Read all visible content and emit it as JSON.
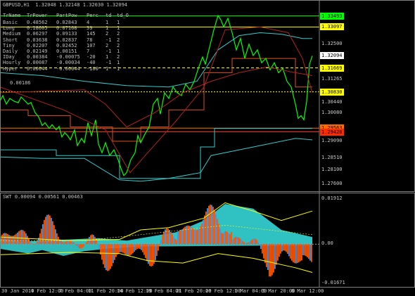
{
  "chart_data": {
    "type": "line",
    "main": {
      "header": "GBPUSD,H1  1.32048 1.32148 1.32030 1.32094",
      "symbol": "GBPUSD",
      "timeframe": "H1",
      "ohlc": {
        "open": 1.32048,
        "high": 1.32148,
        "low": 1.3203,
        "close": 1.32094
      },
      "ylim": [
        1.274,
        1.3375
      ],
      "y_ticks": [
        "1.33493",
        "1.33097",
        "1.32500",
        "1.32094",
        "1.31669",
        "1.31265",
        "1.30830",
        "1.30440",
        "1.30080",
        "1.29563",
        "1.29428",
        "1.29090",
        "1.28510",
        "1.28100",
        "1.27600"
      ],
      "price_labels": [
        {
          "text": "1.33493",
          "value": 1.3349,
          "color": "#00ff00"
        },
        {
          "text": "1.33097",
          "value": 1.331,
          "color": "#ffff00"
        },
        {
          "text": "1.32094",
          "value": 1.32094,
          "color": "#ffffff"
        },
        {
          "text": "1.31669",
          "value": 1.3167,
          "color": "#ffff00"
        },
        {
          "text": "1.30830",
          "value": 1.3083,
          "color": "#ffff00"
        },
        {
          "text": "1.29563",
          "value": 1.2956,
          "color": "#ff6a00"
        },
        {
          "text": "1.29428",
          "value": 1.2943,
          "color": "#ff2a00"
        }
      ],
      "table_headers": [
        "TrName",
        "TrPower",
        "PartPow",
        "Perc",
        "td",
        "td_O"
      ],
      "table_rows": [
        [
          "Basic",
          "0.48562",
          "0.02843",
          "4",
          "1",
          "1"
        ],
        [
          "Long",
          "0.18605",
          "0.07168",
          "39",
          "1",
          "1"
        ],
        [
          "Medium",
          "0.06297",
          "0.09133",
          "145",
          "2",
          "2"
        ],
        [
          "Short",
          "0.03638",
          "0.02837",
          "78",
          "-1",
          "2"
        ],
        [
          "Tiny",
          "0.02207",
          "0.02452",
          "107",
          "2",
          "2"
        ],
        [
          "Daily",
          "0.02149",
          "0.00151",
          "7",
          "-1",
          "1"
        ],
        [
          "IDay",
          "0.00384",
          "-0.00075",
          "-20",
          "1",
          "2"
        ],
        [
          "Hourly",
          "0.00087",
          "-0.00034",
          "-40",
          "-1",
          "1"
        ],
        [
          "Hyper",
          "0.00044",
          "-0.00044",
          "-100",
          "1",
          "1"
        ]
      ],
      "footer_value": "0.00186",
      "series": [
        {
          "points": [
            [
              0,
              1.305
            ],
            [
              4,
              1.307
            ],
            [
              9,
              1.304
            ],
            [
              14,
              1.306
            ],
            [
              20,
              1.305
            ],
            [
              26,
              1.3045
            ],
            [
              30,
              1.3065
            ],
            [
              34,
              1.3055
            ],
            [
              40,
              1.304
            ],
            [
              44,
              1.3046
            ],
            [
              50,
              1.301
            ],
            [
              55,
              1.2995
            ],
            [
              60,
              1.2965
            ],
            [
              64,
              1.2975
            ],
            [
              70,
              1.2955
            ],
            [
              74,
              1.2968
            ],
            [
              80,
              1.295
            ],
            [
              84,
              1.2962
            ],
            [
              88,
              1.2925
            ],
            [
              92,
              1.294
            ],
            [
              96,
              1.293
            ],
            [
              100,
              1.2915
            ],
            [
              106,
              1.295
            ],
            [
              110,
              1.2895
            ],
            [
              116,
              1.292
            ],
            [
              120,
              1.2905
            ],
            [
              125,
              1.2975
            ],
            [
              130,
              1.293
            ],
            [
              136,
              1.2985
            ],
            [
              140,
              1.29
            ],
            [
              145,
              1.287
            ],
            [
              150,
              1.2905
            ],
            [
              156,
              1.286
            ],
            [
              162,
              1.288
            ],
            [
              168,
              1.2845
            ],
            [
              172,
              1.2815
            ],
            [
              176,
              1.279
            ],
            [
              180,
              1.28
            ],
            [
              186,
              1.2845
            ],
            [
              192,
              1.287
            ],
            [
              196,
              1.293
            ],
            [
              200,
              1.2905
            ],
            [
              206,
              1.2935
            ],
            [
              212,
              1.296
            ],
            [
              218,
              1.304
            ],
            [
              224,
              1.306
            ],
            [
              228,
              1.3005
            ],
            [
              234,
              1.308
            ],
            [
              240,
              1.306
            ],
            [
              246,
              1.31
            ],
            [
              252,
              1.308
            ],
            [
              258,
              1.307
            ],
            [
              264,
              1.311
            ],
            [
              270,
              1.309
            ],
            [
              276,
              1.312
            ],
            [
              282,
              1.3165
            ],
            [
              288,
              1.3205
            ],
            [
              292,
              1.318
            ],
            [
              298,
              1.324
            ],
            [
              304,
              1.33
            ],
            [
              310,
              1.335
            ],
            [
              314,
              1.3335
            ],
            [
              318,
              1.331
            ],
            [
              324,
              1.334
            ],
            [
              330,
              1.329
            ],
            [
              336,
              1.323
            ],
            [
              342,
              1.327
            ],
            [
              348,
              1.32
            ],
            [
              354,
              1.325
            ],
            [
              360,
              1.321
            ],
            [
              366,
              1.323
            ],
            [
              372,
              1.3185
            ],
            [
              378,
              1.32
            ],
            [
              384,
              1.316
            ],
            [
              390,
              1.3185
            ],
            [
              396,
              1.315
            ],
            [
              402,
              1.3165
            ],
            [
              408,
              1.312
            ],
            [
              414,
              1.31
            ],
            [
              420,
              1.304
            ],
            [
              424,
              1.299
            ],
            [
              428,
              1.3
            ],
            [
              432,
              1.2985
            ],
            [
              436,
              1.305
            ],
            [
              440,
              1.318
            ],
            [
              444,
              1.3209
            ]
          ],
          "color": "#00ff00"
        },
        {
          "points": [
            [
              0,
              1.315
            ],
            [
              60,
              1.314
            ],
            [
              120,
              1.312
            ],
            [
              180,
              1.3105
            ],
            [
              240,
              1.31
            ],
            [
              280,
              1.312
            ],
            [
              310,
              1.323
            ],
            [
              340,
              1.328
            ],
            [
              370,
              1.329
            ],
            [
              400,
              1.3285
            ],
            [
              430,
              1.327
            ],
            [
              444,
              1.327
            ]
          ],
          "color": "#33cccc"
        },
        {
          "points": [
            [
              0,
              1.2855
            ],
            [
              60,
              1.285
            ],
            [
              120,
              1.285
            ],
            [
              170,
              1.2775
            ],
            [
              200,
              1.277
            ],
            [
              240,
              1.278
            ],
            [
              285,
              1.28
            ],
            [
              300,
              1.286
            ],
            [
              340,
              1.288
            ],
            [
              380,
              1.29
            ],
            [
              420,
              1.292
            ],
            [
              444,
              1.2915
            ]
          ],
          "color": "#33cccc"
        },
        {
          "points": [
            [
              0,
              1.308
            ],
            [
              120,
              1.309
            ],
            [
              150,
              1.304
            ],
            [
              180,
              1.296
            ],
            [
              220,
              1.301
            ],
            [
              260,
              1.308
            ],
            [
              300,
              1.312
            ],
            [
              340,
              1.315
            ],
            [
              380,
              1.317
            ],
            [
              420,
              1.315
            ],
            [
              444,
              1.314
            ]
          ],
          "color": "#b22222"
        },
        {
          "points": [
            [
              0,
              1.31
            ],
            [
              90,
              1.302
            ],
            [
              150,
              1.295
            ],
            [
              185,
              1.28
            ],
            [
              210,
              1.287
            ],
            [
              250,
              1.298
            ],
            [
              290,
              1.31
            ],
            [
              320,
              1.33
            ],
            [
              370,
              1.331
            ],
            [
              410,
              1.329
            ],
            [
              430,
              1.32
            ],
            [
              444,
              1.308
            ]
          ],
          "color": "#b22222"
        }
      ]
    },
    "oscillator": {
      "header": "SWT 0.00094 0.00561 0.00463",
      "ylim": [
        -0.0175,
        0.02
      ],
      "y_ticks": [
        "0.01912",
        "0.00",
        "-0.01671"
      ],
      "histogram_colors": [
        "#ff5500",
        "#00cccc",
        "#3399ff",
        "#ffff00"
      ],
      "bands": [
        {
          "points": [
            [
              0,
              0.003
            ],
            [
              100,
              0.0015
            ],
            [
              170,
              0.002
            ],
            [
              200,
              0.006
            ],
            [
              240,
              0.007
            ],
            [
              290,
              0.011
            ],
            [
              320,
              0.0175
            ],
            [
              360,
              0.014
            ],
            [
              400,
              0.01
            ],
            [
              444,
              0.014
            ]
          ],
          "color": "#ffff00"
        },
        {
          "points": [
            [
              0,
              -0.0045
            ],
            [
              100,
              -0.0035
            ],
            [
              170,
              -0.004
            ],
            [
              210,
              -0.007
            ],
            [
              260,
              -0.008
            ],
            [
              310,
              -0.004
            ],
            [
              360,
              -0.006
            ],
            [
              420,
              -0.01
            ],
            [
              444,
              -0.012
            ]
          ],
          "color": "#ffff00"
        }
      ]
    },
    "x_ticks": [
      "30 Jan 2019",
      "4 Feb 12:00",
      "7 Feb 04:00",
      "11 Feb 20:00",
      "14 Feb 12:00",
      "19 Feb 04:00",
      "21 Feb 20:00",
      "26 Feb 12:00",
      "1 Mar 04:00",
      "5 Mar 20:00",
      "8 Mar 12:00"
    ]
  }
}
